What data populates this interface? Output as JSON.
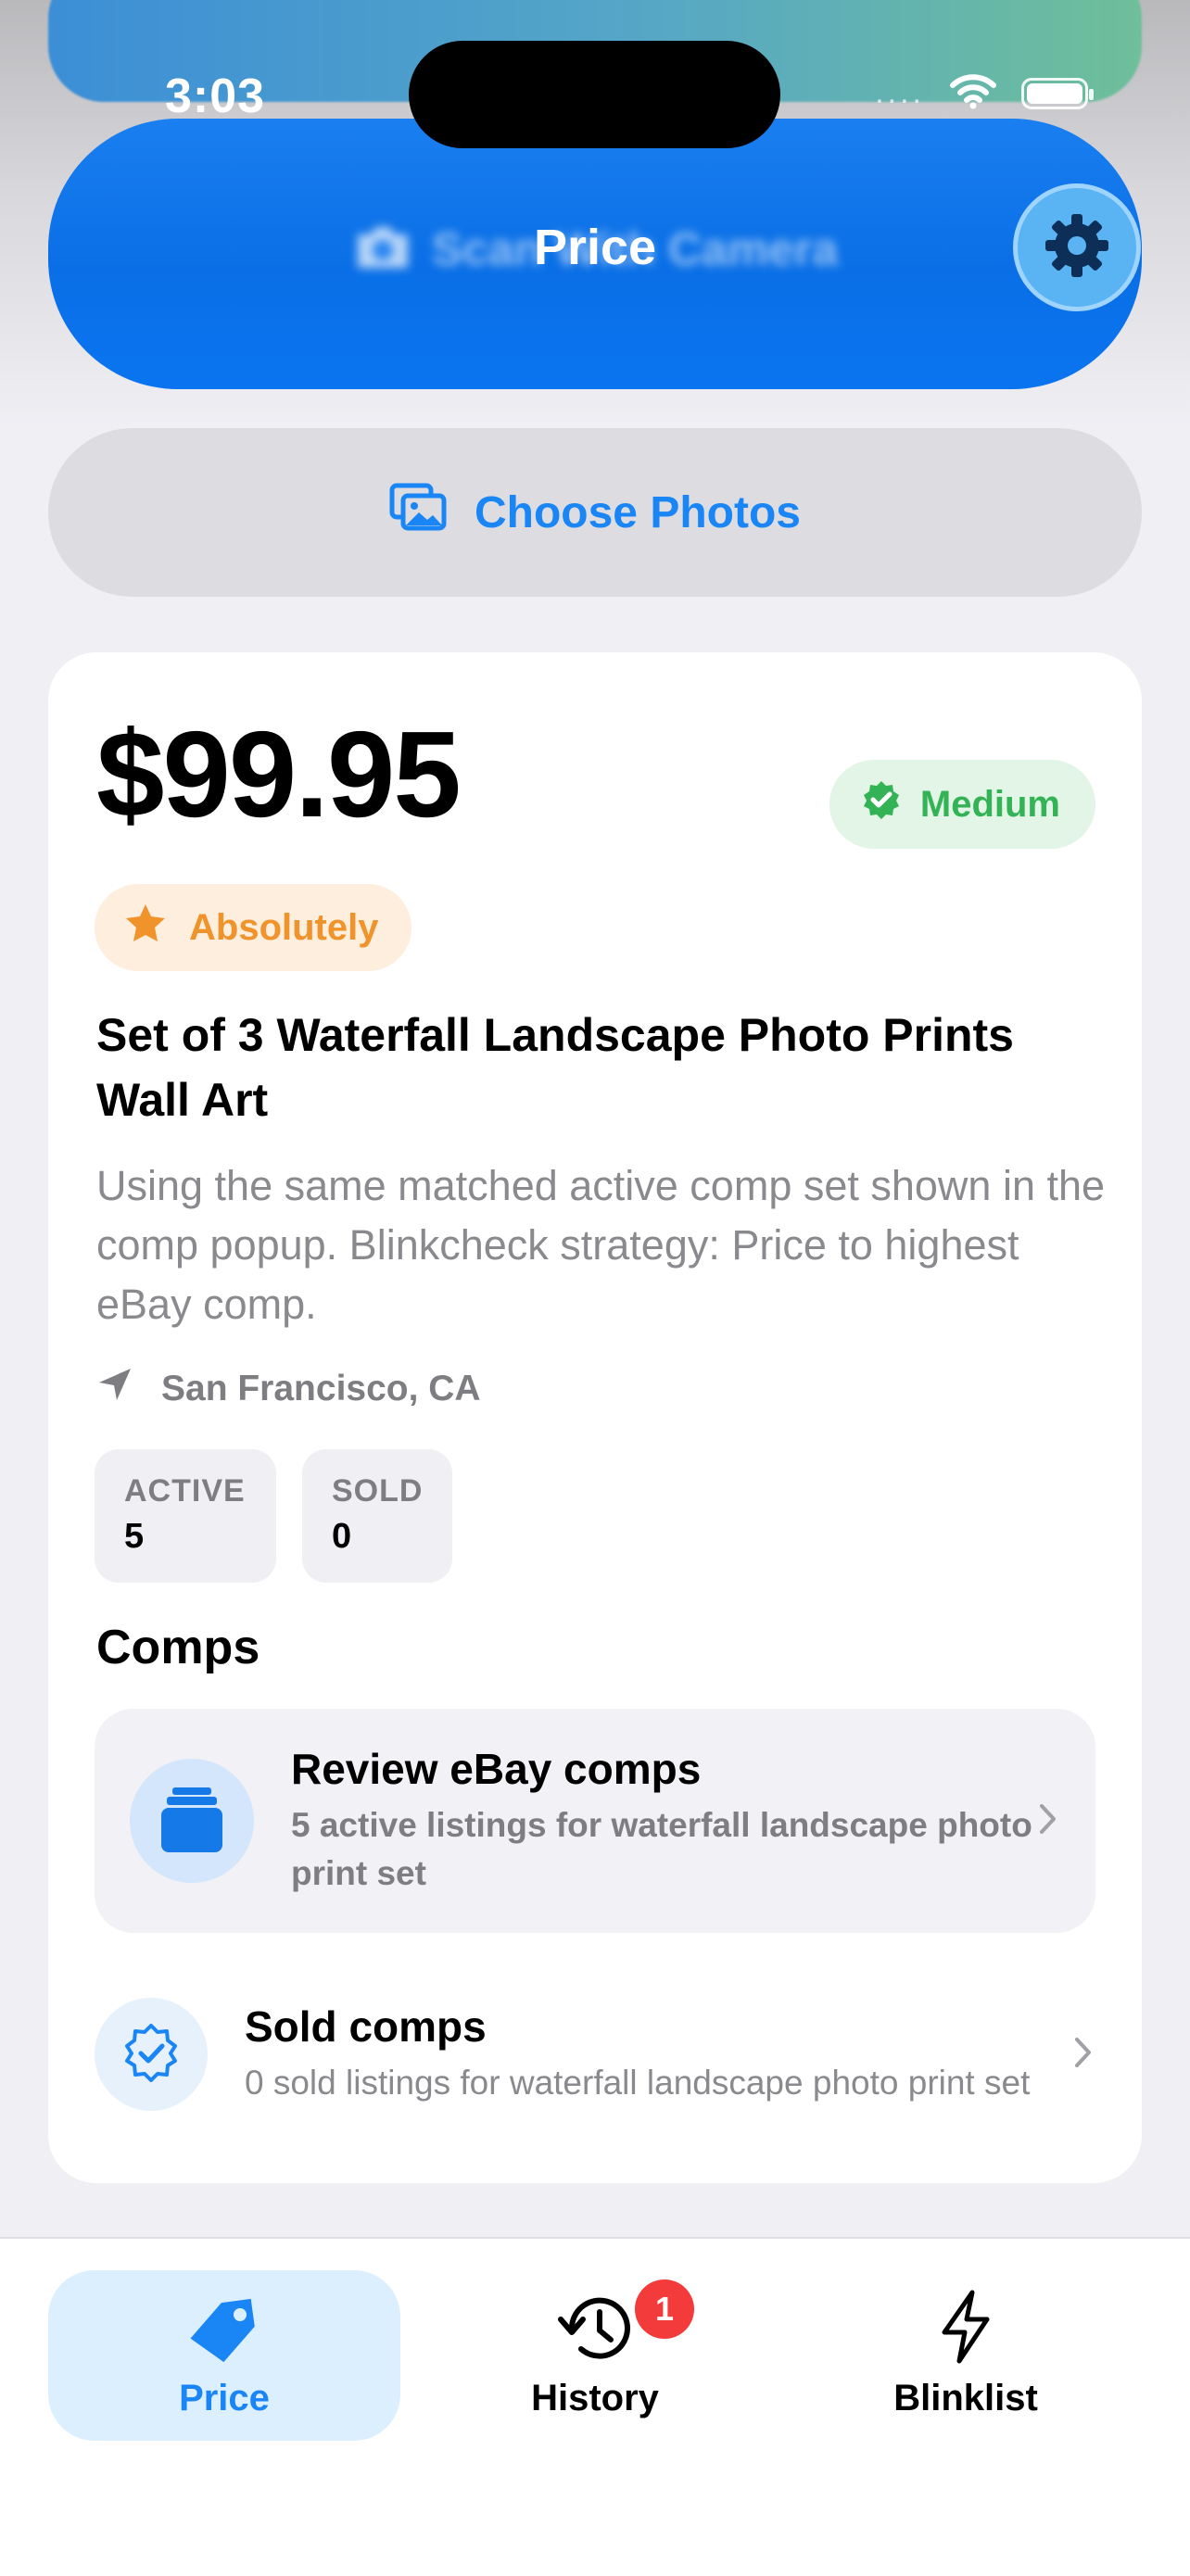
{
  "status_bar": {
    "time": "3:03",
    "signal": "...."
  },
  "header": {
    "title": "Price",
    "camera_button_label": "Scan With Camera"
  },
  "choose_photos": {
    "label": "Choose Photos"
  },
  "result": {
    "price": "$99.95",
    "confidence_badge": "Medium",
    "recommendation_badge": "Absolutely",
    "item_title": "Set of 3 Waterfall Landscape Photo Prints Wall Art",
    "description": "Using the same matched active comp set shown in the comp popup. Blinkcheck strategy: Price to highest eBay comp.",
    "location": "San Francisco, CA",
    "stats": {
      "active_label": "ACTIVE",
      "active_value": "5",
      "sold_label": "SOLD",
      "sold_value": "0"
    },
    "comps": {
      "heading": "Comps",
      "review": {
        "title": "Review eBay comps",
        "subtitle": "5 active listings for waterfall landscape photo print set"
      },
      "sold": {
        "title": "Sold comps",
        "subtitle": "0 sold listings for waterfall landscape photo print set"
      }
    }
  },
  "tabbar": {
    "tabs": [
      {
        "label": "Price",
        "icon": "tag-icon",
        "selected": true
      },
      {
        "label": "History",
        "icon": "history-icon",
        "badge": "1"
      },
      {
        "label": "Blinklist",
        "icon": "bolt-icon"
      }
    ]
  },
  "colors": {
    "accent": "#1a86f5",
    "camera_button": "#0a74f0",
    "medium_green": "#34b356",
    "absolutely_orange": "#f0932b",
    "badge_red": "#f43b3b"
  }
}
